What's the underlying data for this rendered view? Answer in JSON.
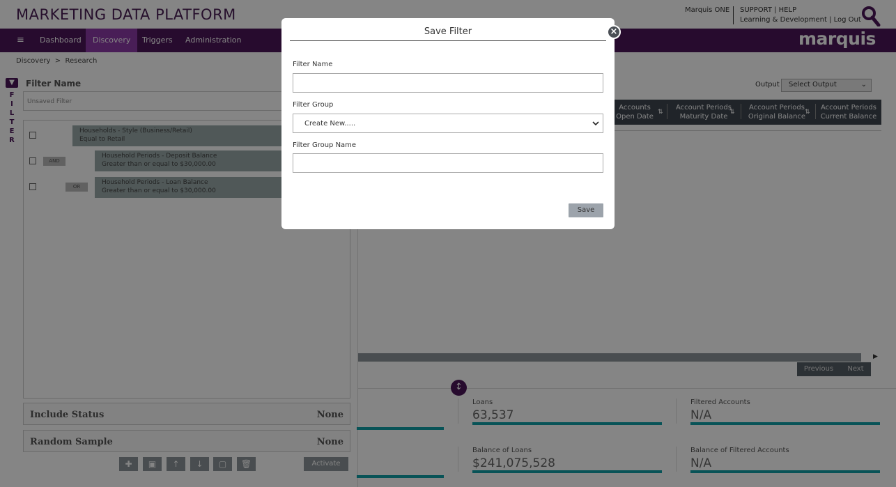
{
  "header": {
    "brand": "MARKETING DATA PLATFORM",
    "user_name": "Marquis ONE",
    "support_help": "SUPPORT | HELP",
    "learning_logout": "Learning & Development | Log Out",
    "logo": "marquis"
  },
  "nav": {
    "menu_icon": "≡",
    "items": [
      {
        "label": "Dashboard"
      },
      {
        "label": "Discovery"
      },
      {
        "label": "Triggers"
      },
      {
        "label": "Administration"
      }
    ]
  },
  "breadcrumb": "Discovery  >  Research",
  "filter_panel": {
    "tab_letters": "F\nI\nL\nT\nE\nR",
    "filter_name_label": "Filter Name",
    "filter_name_value": "Unsaved Filter",
    "rules": [
      {
        "title": "Households - Style (Business/Retail)",
        "condition": "Equal to Retail",
        "operator": ""
      },
      {
        "title": "Household Periods - Deposit Balance",
        "condition": "Greater than or equal to $30,000.00",
        "operator": "AND"
      },
      {
        "title": "Household Periods - Loan Balance",
        "condition": "Greater than or equal to $30,000.00",
        "operator": "OR"
      }
    ],
    "include_status_label": "Include Status",
    "include_status_value": "None",
    "random_sample_label": "Random Sample",
    "random_sample_value": "None",
    "activate_label": "Activate"
  },
  "results": {
    "output_label": "Output",
    "output_select": "Select Output",
    "columns": [
      {
        "line1": "Accounts",
        "line2": "Open Date"
      },
      {
        "line1": "Account Periods",
        "line2": "Maturity Date"
      },
      {
        "line1": "Account Periods",
        "line2": "Original Balance"
      },
      {
        "line1": "Account Periods",
        "line2": "Current Balance"
      }
    ],
    "previous_label": "Previous",
    "next_label": "Next"
  },
  "stats": [
    {
      "label": "Loans",
      "value": "63,537"
    },
    {
      "label": "Filtered Accounts",
      "value": "N/A"
    },
    {
      "label": "Balance of Loans",
      "value": "$241,075,528"
    },
    {
      "label": "Balance of Filtered Accounts",
      "value": "N/A"
    }
  ],
  "modal": {
    "title": "Save Filter",
    "filter_name_label": "Filter Name",
    "filter_name_value": "",
    "filter_group_label": "Filter Group",
    "filter_group_selected": "Create New.....",
    "filter_group_name_label": "Filter Group Name",
    "filter_group_name_value": "",
    "save_label": "Save"
  },
  "colors": {
    "brand_purple": "#4b1658",
    "active_nav": "#8d3aa8",
    "stat_bar": "#11a0a8",
    "table_header": "#3e4650"
  }
}
